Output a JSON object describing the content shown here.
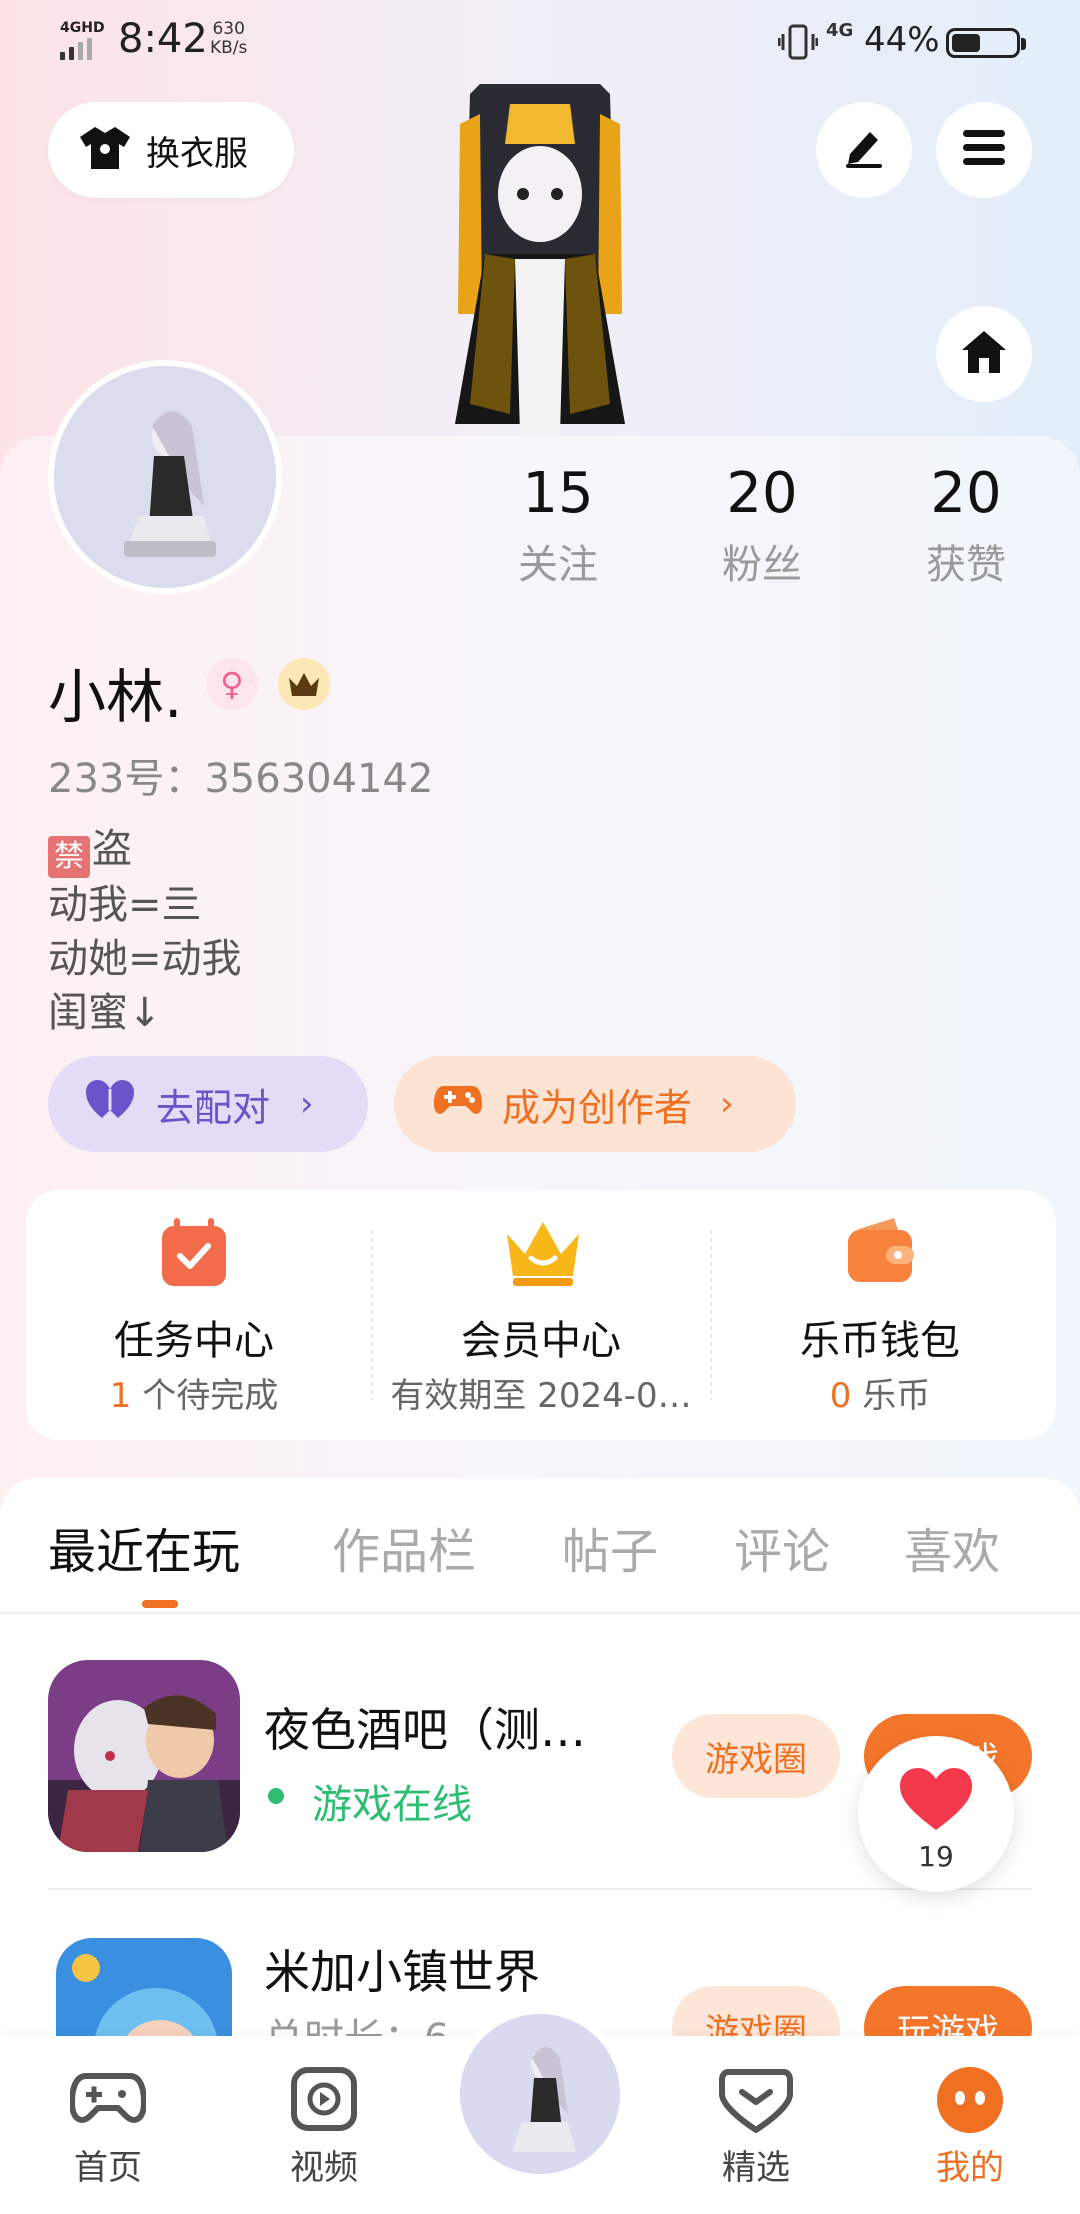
{
  "status_bar": {
    "network": "4GHD",
    "time": "8:42",
    "speed_value": "630",
    "speed_unit": "KB/s",
    "mobile": "4G",
    "battery": "44%"
  },
  "header": {
    "outfit_label": "换衣服",
    "icons": [
      "shirt-icon",
      "pen-icon",
      "menu-icon",
      "home-icon"
    ]
  },
  "stats": [
    {
      "value": "15",
      "label": "关注"
    },
    {
      "value": "20",
      "label": "粉丝"
    },
    {
      "value": "20",
      "label": "获赞"
    }
  ],
  "profile": {
    "nickname": "小林.",
    "gender_symbol": "♀",
    "uid": "233号：356304142",
    "bio_ban_char": "禁",
    "bio_line1_rest": "盗",
    "bio_line2": "动我=亖",
    "bio_line3": "动她=动我",
    "bio_line4": "闺蜜↓"
  },
  "actions": {
    "pair_label": "去配对",
    "creator_label": "成为创作者",
    "arrow": "›"
  },
  "services": [
    {
      "title": "任务中心",
      "highlight": "1",
      "sub": " 个待完成"
    },
    {
      "title": "会员中心",
      "highlight": "",
      "sub": "有效期至 2024-0…"
    },
    {
      "title": "乐币钱包",
      "highlight": "0",
      "sub": " 乐币"
    }
  ],
  "tabs": [
    "最近在玩",
    "作品栏",
    "帖子",
    "评论",
    "喜欢"
  ],
  "games": [
    {
      "title": "夜色酒吧（测…",
      "status": "游戏在线",
      "circle_label": "游戏圈",
      "play_label": "玩游戏"
    },
    {
      "title": "米加小镇世界",
      "sub": "总时长：6",
      "circle_label": "游戏圈",
      "play_label": "玩游戏"
    }
  ],
  "float_like": {
    "count": "19"
  },
  "bottom_nav": [
    {
      "label": "首页"
    },
    {
      "label": "视频"
    },
    {
      "label": "精选"
    },
    {
      "label": "我的"
    }
  ],
  "colors": {
    "accent": "#f07022",
    "online": "#2dbd73",
    "pair": "#6b54c9"
  }
}
